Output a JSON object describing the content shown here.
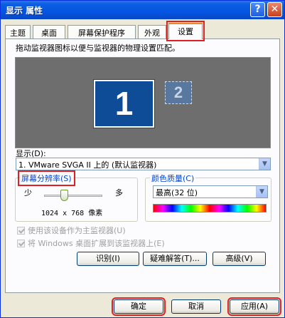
{
  "window": {
    "title": "显示 属性",
    "help_label": "?",
    "close_label": "✕"
  },
  "tabs": [
    {
      "label": "主题"
    },
    {
      "label": "桌面"
    },
    {
      "label": "屏幕保护程序"
    },
    {
      "label": "外观"
    },
    {
      "label": "设置"
    }
  ],
  "settings": {
    "instruction": "拖动监视器图标以便与监视器的物理设置匹配。",
    "monitor_1_label": "1",
    "monitor_2_label": "2",
    "display_label": "显示(D):",
    "display_value": "1. VMware SVGA II 上的 (默认监视器)",
    "resolution": {
      "title": "屏幕分辨率(S)",
      "less_label": "少",
      "more_label": "多",
      "value_text": "1024 x 768 像素",
      "slider_fraction": 0.35
    },
    "color_quality": {
      "title": "颜色质量(C)",
      "value": "最高(32 位)"
    },
    "checkbox_primary": "使用该设备作为主监视器(U)",
    "checkbox_extend": "将 Windows 桌面扩展到该监视器上(E)",
    "identify_button": "识别(I)",
    "troubleshoot_button": "疑难解答(T)...",
    "advanced_button": "高级(V)"
  },
  "footer": {
    "ok_button": "确定",
    "cancel_button": "取消",
    "apply_button": "应用(A)"
  },
  "colors": {
    "titlebar": "#0554e3",
    "highlight": "#e02020",
    "monitor_selected": "#0e4c97"
  },
  "icons": [
    "help-icon",
    "close-icon",
    "chevron-down-icon"
  ]
}
